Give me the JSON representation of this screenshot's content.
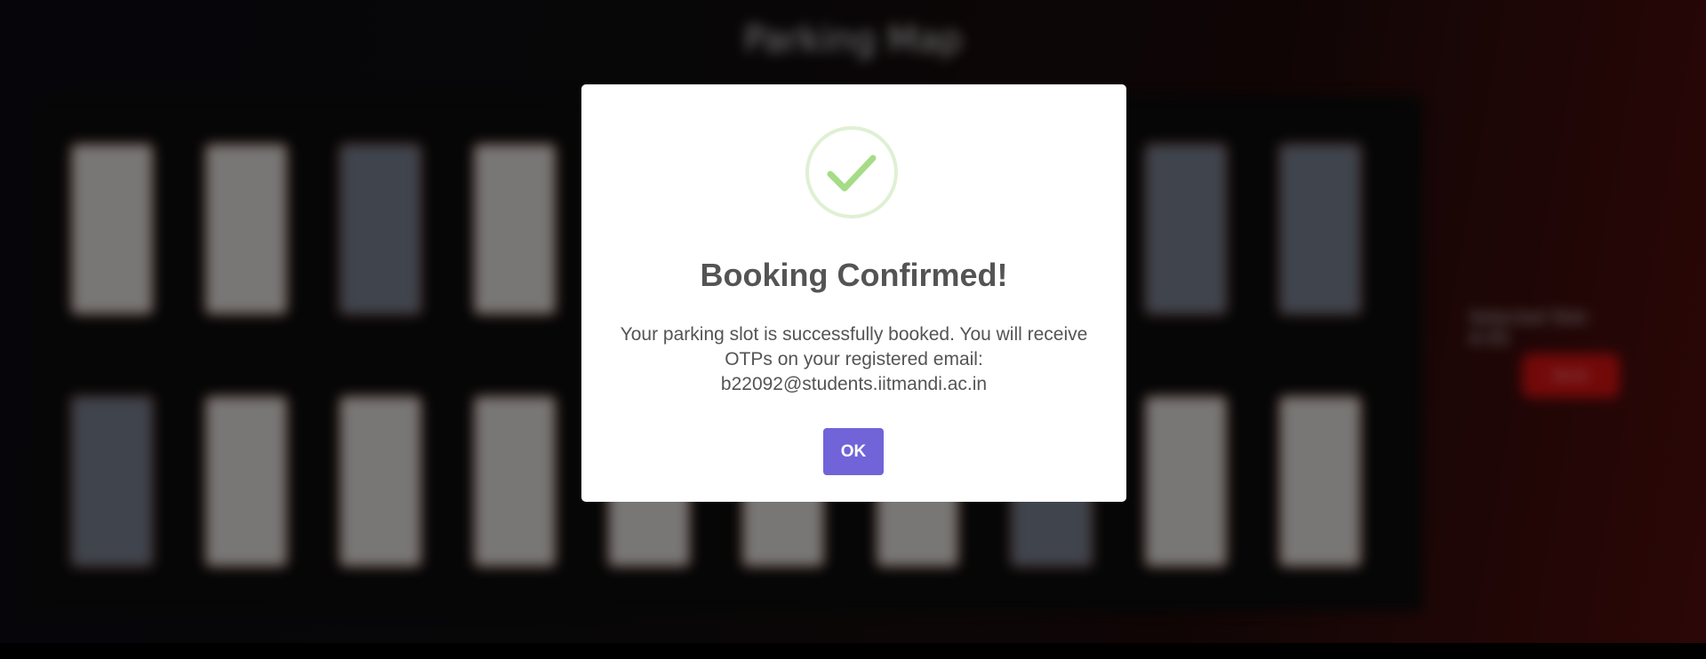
{
  "background": {
    "title": "Parking Map",
    "slots_row1": [
      "free",
      "free",
      "taken",
      "free",
      "free",
      "free",
      "free",
      "free",
      "taken",
      "taken"
    ],
    "slots_row2": [
      "taken",
      "free",
      "free",
      "free",
      "free",
      "free",
      "free",
      "taken",
      "free",
      "free"
    ],
    "side_text": "Selected Slot: A-05",
    "side_button": "Book"
  },
  "modal": {
    "icon": "checkmark-icon",
    "title": "Booking Confirmed!",
    "message": "Your parking slot is successfully booked. You will receive OTPs on your registered email: b22092@students.iitmandi.ac.in",
    "ok_label": "OK"
  },
  "colors": {
    "confirm_button": "#7064d8",
    "success_green": "#a5dc86",
    "success_ring": "#dff0d4",
    "text": "#545454"
  }
}
